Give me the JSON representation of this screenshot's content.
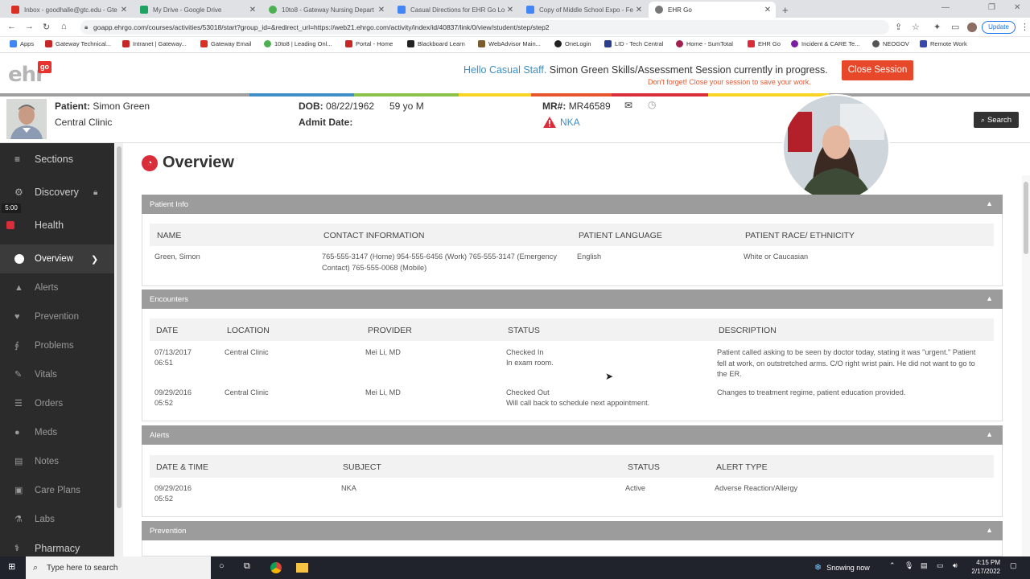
{
  "browser": {
    "tabs": [
      {
        "label": "Inbox - goodhalle@gtc.edu - Gte",
        "color": "#d93025"
      },
      {
        "label": "My Drive - Google Drive",
        "color": "#1ea362"
      },
      {
        "label": "10to8 - Gateway Nursing Depart",
        "color": "#4caf50"
      },
      {
        "label": "Casual Directions for EHR Go Lo",
        "color": "#4285f4"
      },
      {
        "label": "Copy of Middle School Expo - Fe",
        "color": "#4285f4"
      },
      {
        "label": "EHR Go",
        "color": "#555555"
      }
    ],
    "new_tab": "+",
    "url": "goapp.ehrgo.com/courses/activities/53018/start?group_id=&redirect_url=https://web21.ehrgo.com/activity/index/id/40837/link/0/view/student/step/step2",
    "update_label": "Update",
    "bookmarks": [
      {
        "label": "Apps",
        "color": "#4285f4"
      },
      {
        "label": "Gateway Technical...",
        "color": "#c62828"
      },
      {
        "label": "Intranet | Gateway...",
        "color": "#c62828"
      },
      {
        "label": "Gateway Email",
        "color": "#d93025"
      },
      {
        "label": "10to8 | Leading Onl...",
        "color": "#4caf50"
      },
      {
        "label": "Portal - Home",
        "color": "#c62828"
      },
      {
        "label": "Blackboard Learn",
        "color": "#222222"
      },
      {
        "label": "WebAdvisor Main...",
        "color": "#7a5c2e"
      },
      {
        "label": "OneLogin",
        "color": "#222222"
      },
      {
        "label": "LID - Tech Central",
        "color": "#2c3e8f"
      },
      {
        "label": "Home - SumTotal",
        "color": "#a02050"
      },
      {
        "label": "EHR Go",
        "color": "#d92d3a"
      },
      {
        "label": "Incident & CARE Te...",
        "color": "#7b1fa2"
      },
      {
        "label": "NEOGOV",
        "color": "#555555"
      },
      {
        "label": "Remote Work",
        "color": "#3949ab"
      }
    ]
  },
  "header": {
    "logo_text": "ehr",
    "logo_badge": "go",
    "greeting_highlight": "Hello Casual Staff.",
    "greeting_rest": " Simon Green Skills/Assessment Session currently in progress.",
    "reminder": "Don't forget! Close your session to save your work.",
    "close_session": "Close Session",
    "accent_colors": [
      "#9e9e9e",
      "#3f8fc5",
      "#8bc34a",
      "#f9d423",
      "#e8552d",
      "#d92d3a",
      "#f9d423",
      "#9e9e9e"
    ]
  },
  "patient": {
    "patient_label": "Patient:",
    "name": "Simon Green",
    "clinic": "Central Clinic",
    "dob_label": "DOB:",
    "dob": "08/22/1962",
    "age": "59 yo M",
    "admit_label": "Admit Date:",
    "mr_label": "MR#:",
    "mr": "MR46589",
    "allergy": "NKA",
    "search": "Search"
  },
  "sidebar": {
    "sections": "Sections",
    "timer": "5:00",
    "items": [
      {
        "label": "Discovery"
      },
      {
        "label": "Health"
      },
      {
        "label": "Overview"
      },
      {
        "label": "Alerts"
      },
      {
        "label": "Prevention"
      },
      {
        "label": "Problems"
      },
      {
        "label": "Vitals"
      },
      {
        "label": "Orders"
      },
      {
        "label": "Meds"
      },
      {
        "label": "Notes"
      },
      {
        "label": "Care Plans"
      },
      {
        "label": "Labs"
      },
      {
        "label": "Pharmacy"
      }
    ]
  },
  "main": {
    "title": "Overview",
    "patient_info": {
      "header": "Patient Info",
      "columns": [
        "NAME",
        "CONTACT INFORMATION",
        "PATIENT LANGUAGE",
        "PATIENT RACE/ ETHNICITY"
      ],
      "row": {
        "name": "Green, Simon",
        "contact": "765-555-3147 (Home) 954-555-6456 (Work) 765-555-3147 (Emergency Contact) 765-555-0068 (Mobile)",
        "language": "English",
        "race": "White or Caucasian"
      }
    },
    "encounters": {
      "header": "Encounters",
      "columns": [
        "DATE",
        "LOCATION",
        "PROVIDER",
        "STATUS",
        "DESCRIPTION"
      ],
      "rows": [
        {
          "date": "07/13/2017",
          "time": "06:51",
          "location": "Central Clinic",
          "provider": "Mei Li, MD",
          "status": "Checked In",
          "status2": "In exam room.",
          "description": "Patient called asking to be seen by doctor today, stating it was \"urgent.\" Patient fell at work, on outstretched arms. C/O right wrist pain. He did not want to go to the ER."
        },
        {
          "date": "09/29/2016",
          "time": "05:52",
          "location": "Central Clinic",
          "provider": "Mei Li, MD",
          "status": "Checked Out",
          "status2": "Will call back to schedule next appointment.",
          "description": "Changes to treatment regime, patient education provided."
        }
      ]
    },
    "alerts": {
      "header": "Alerts",
      "columns": [
        "DATE & TIME",
        "SUBJECT",
        "STATUS",
        "ALERT TYPE"
      ],
      "rows": [
        {
          "date": "09/29/2016",
          "time": "05:52",
          "subject": "NKA",
          "status": "Active",
          "type": "Adverse Reaction/Allergy"
        }
      ]
    },
    "prevention": {
      "header": "Prevention"
    }
  },
  "taskbar": {
    "search_placeholder": "Type here to search",
    "weather": "Snowing now",
    "time": "4:15 PM",
    "date": "2/17/2022"
  }
}
